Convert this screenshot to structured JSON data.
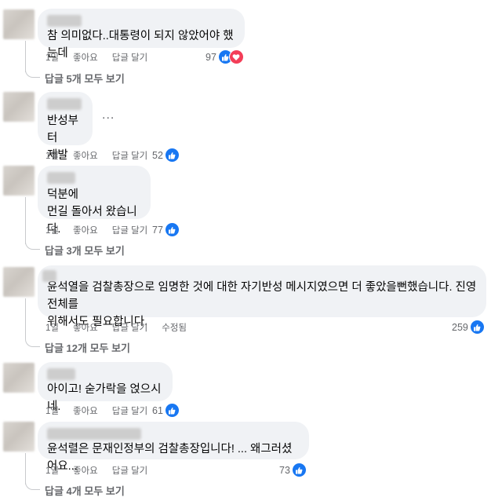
{
  "comments": [
    {
      "text": "참 의미없다..대통령이 되지 않았어야 했는데",
      "time": "1일",
      "like": "좋아요",
      "reply": "답글 달기",
      "react_count": "97",
      "reactions": [
        "like-icon",
        "heart-icon"
      ],
      "replies_label": "답글 5개 모두 보기"
    },
    {
      "text": "반성부터\n제발",
      "time": "1일",
      "like": "좋아요",
      "reply": "답글 달기",
      "react_count": "52",
      "reactions": [
        "like-icon"
      ],
      "more": "..."
    },
    {
      "text": "덕분에\n먼길 돌아서 왔습니다.",
      "time": "1일",
      "like": "좋아요",
      "reply": "답글 달기",
      "react_count": "77",
      "reactions": [
        "like-icon"
      ],
      "replies_label": "답글 3개 모두 보기"
    },
    {
      "text": "윤석열을 검찰총장으로 임명한 것에 대한 자기반성 메시지였으면 더 좋았을뻔했습니다. 진영 전체를\n위해서도 필요합니다.",
      "time": "1일",
      "like": "좋아요",
      "reply": "답글 달기",
      "edited": "수정됨",
      "react_count": "259",
      "reactions": [
        "like-icon"
      ],
      "replies_label": "답글 12개 모두 보기"
    },
    {
      "text": "아이고! 숟가락을 얹으시네.",
      "time": "1일",
      "like": "좋아요",
      "reply": "답글 달기",
      "react_count": "61",
      "reactions": [
        "like-icon"
      ]
    },
    {
      "text": "윤석렬은 문재인정부의 검찰총장입니다! ... 왜그러셨어요...",
      "time": "1일",
      "like": "좋아요",
      "reply": "답글 달기",
      "react_count": "73",
      "reactions": [
        "like-icon"
      ],
      "replies_label": "답글 4개 모두 보기"
    }
  ],
  "colors": {
    "like": "#1877f2",
    "heart": "#f33e58",
    "bubble": "#f0f2f5",
    "meta": "#65676b"
  }
}
